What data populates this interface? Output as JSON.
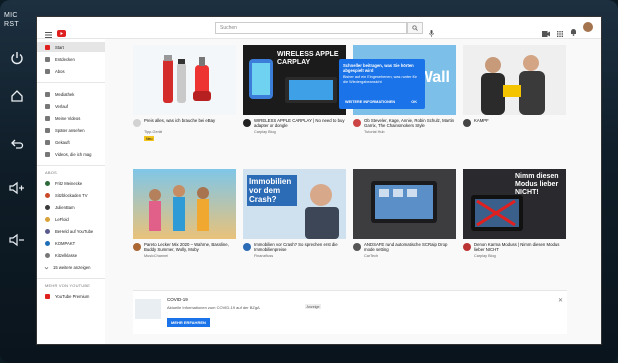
{
  "hardware": {
    "mic_label": "MIC",
    "rst_label": "RST",
    "colors": {
      "bezel": "#13232f",
      "icon": "#e9eef2"
    }
  },
  "topbar": {
    "search_placeholder": "Suchen"
  },
  "nav": {
    "main": [
      {
        "label": "Start",
        "active": true
      },
      {
        "label": "Entdecken"
      },
      {
        "label": "Abos"
      }
    ],
    "library": [
      {
        "label": "Mediathek"
      },
      {
        "label": "Verlauf"
      },
      {
        "label": "Meine Videos"
      },
      {
        "label": "Später ansehen"
      },
      {
        "label": "Gekauft"
      },
      {
        "label": "Videos, die ich mag"
      }
    ],
    "abos_heading": "ABOS",
    "subscriptions": [
      {
        "label": "Fritz Meinecke",
        "color": "#2e6b3a"
      },
      {
        "label": "Sitzblockaden TV",
        "color": "#c94b2a"
      },
      {
        "label": "JulienBam",
        "color": "#3b3b3b"
      },
      {
        "label": "LeFloid",
        "color": "#d9a23c"
      },
      {
        "label": "BeHeld auf YouTube",
        "color": "#5a5a8c"
      },
      {
        "label": "KOMPAKT",
        "color": "#1f6fb8"
      },
      {
        "label": "Kitzelklasse",
        "color": "#777"
      }
    ],
    "show_more": "15 weitere anzeigen",
    "more_heading": "MEHR VON YOUTUBE",
    "premium": "YouTube Premium"
  },
  "videos": [
    {
      "title": "Preis alles, was ich brauche bei eBay",
      "channel": "Tipp-Gerät",
      "stats": "",
      "badge": "Neu",
      "avatar": "#d2d2d2"
    },
    {
      "title": "WIRELESS APPLE CARPLAY | No need to buy adapter or dongle",
      "channel": "Carplay Blog",
      "stats": "",
      "avatar": "#222"
    },
    {
      "title": "Ob Steveler, Kage, Annie, Robin Schulz, Martin Garrix, The Chainsmokers Style",
      "channel": "Tutorial Hub",
      "stats": "",
      "avatar": "#c44"
    },
    {
      "title": "KAMPF",
      "channel": "",
      "stats": "",
      "avatar": "#444"
    },
    {
      "title": "Pareto Lecker Mix 2020 – Wahrne, Bassline, Buddy Summer, Wolly, Moby",
      "channel": "MusicChannel",
      "stats": "",
      "avatar": "#a63"
    },
    {
      "title": "Immobilien vor Crash? So sprechen erst die Immobilienpreise",
      "channel": "Finanzfluss",
      "stats": "",
      "avatar": "#2c6bb5"
    },
    {
      "title": "ANDSAFE rund automatische SCRaip Drop mode setting",
      "channel": "CarTech",
      "stats": "",
      "avatar": "#555"
    },
    {
      "title": "Denon Karma Moduss | Nimm diesen Modus lieber NICHT",
      "channel": "Carplay Blog",
      "stats": "",
      "avatar": "#b33"
    }
  ],
  "thumbnail_text": {
    "carplay": "WIRELESS APPLE CARPLAY",
    "wall": "Wall",
    "immobilien": "Immobilien vor dem Crash?",
    "nimm": "Nimm diesen Modus lieber NICHT!"
  },
  "tooltip": {
    "title": "Schneller beitragen, was Sie hörten abgespielt wird",
    "text": "Bisher auf ein Eingesehenen, was runter für die Wiedergabeansicht",
    "more_info": "WEITERE INFORMATIONEN",
    "ok": "OK"
  },
  "covid": {
    "heading": "COVID-19",
    "text": "Aktuelle Informationen zum COVID-19 auf der BZgA",
    "tag": "Anzeige",
    "button": "MEHR ERFAHREN"
  }
}
